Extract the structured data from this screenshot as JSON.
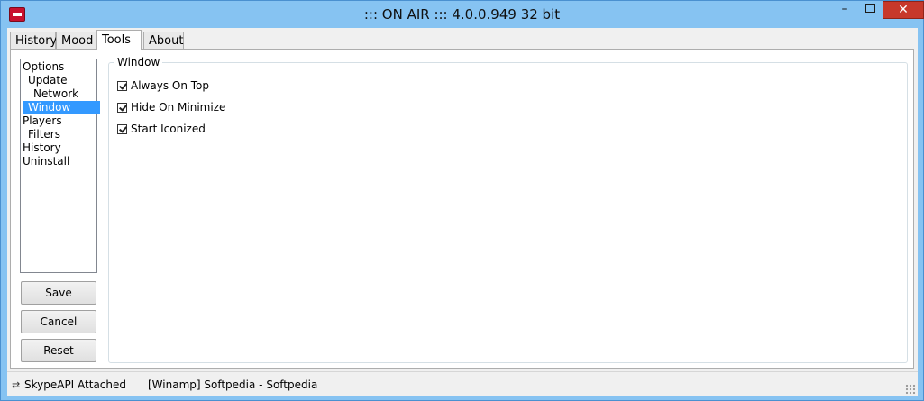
{
  "window": {
    "title": "::: ON AIR ::: 4.0.0.949 32 bit",
    "minimize_glyph": "–",
    "close_glyph": "✕"
  },
  "tabs": [
    {
      "label": "History"
    },
    {
      "label": "Mood"
    },
    {
      "label": "Tools"
    },
    {
      "label": "About"
    }
  ],
  "tree": {
    "items": [
      {
        "label": "Options",
        "level": 0
      },
      {
        "label": "Update",
        "level": 1
      },
      {
        "label": "Network",
        "level": 2
      },
      {
        "label": "Window",
        "level": 1,
        "selected": true
      },
      {
        "label": "Players",
        "level": 0
      },
      {
        "label": "Filters",
        "level": 1
      },
      {
        "label": "History",
        "level": 0
      },
      {
        "label": "Uninstall",
        "level": 0
      }
    ]
  },
  "buttons": {
    "save": "Save",
    "cancel": "Cancel",
    "reset": "Reset"
  },
  "group": {
    "label": "Window",
    "options": [
      {
        "label": "Always On Top",
        "checked": true
      },
      {
        "label": "Hide On Minimize",
        "checked": true
      },
      {
        "label": "Start Iconized",
        "checked": true
      }
    ]
  },
  "status": {
    "skype": "SkypeAPI Attached",
    "player": "[Winamp] Softpedia - Softpedia"
  },
  "colors": {
    "selection": "#3399ff",
    "close_button": "#c7382b",
    "titlebar": "#86c3f2"
  },
  "icons": {
    "app": "on-air-logo-icon",
    "status_sync": "sync-arrows-icon"
  }
}
